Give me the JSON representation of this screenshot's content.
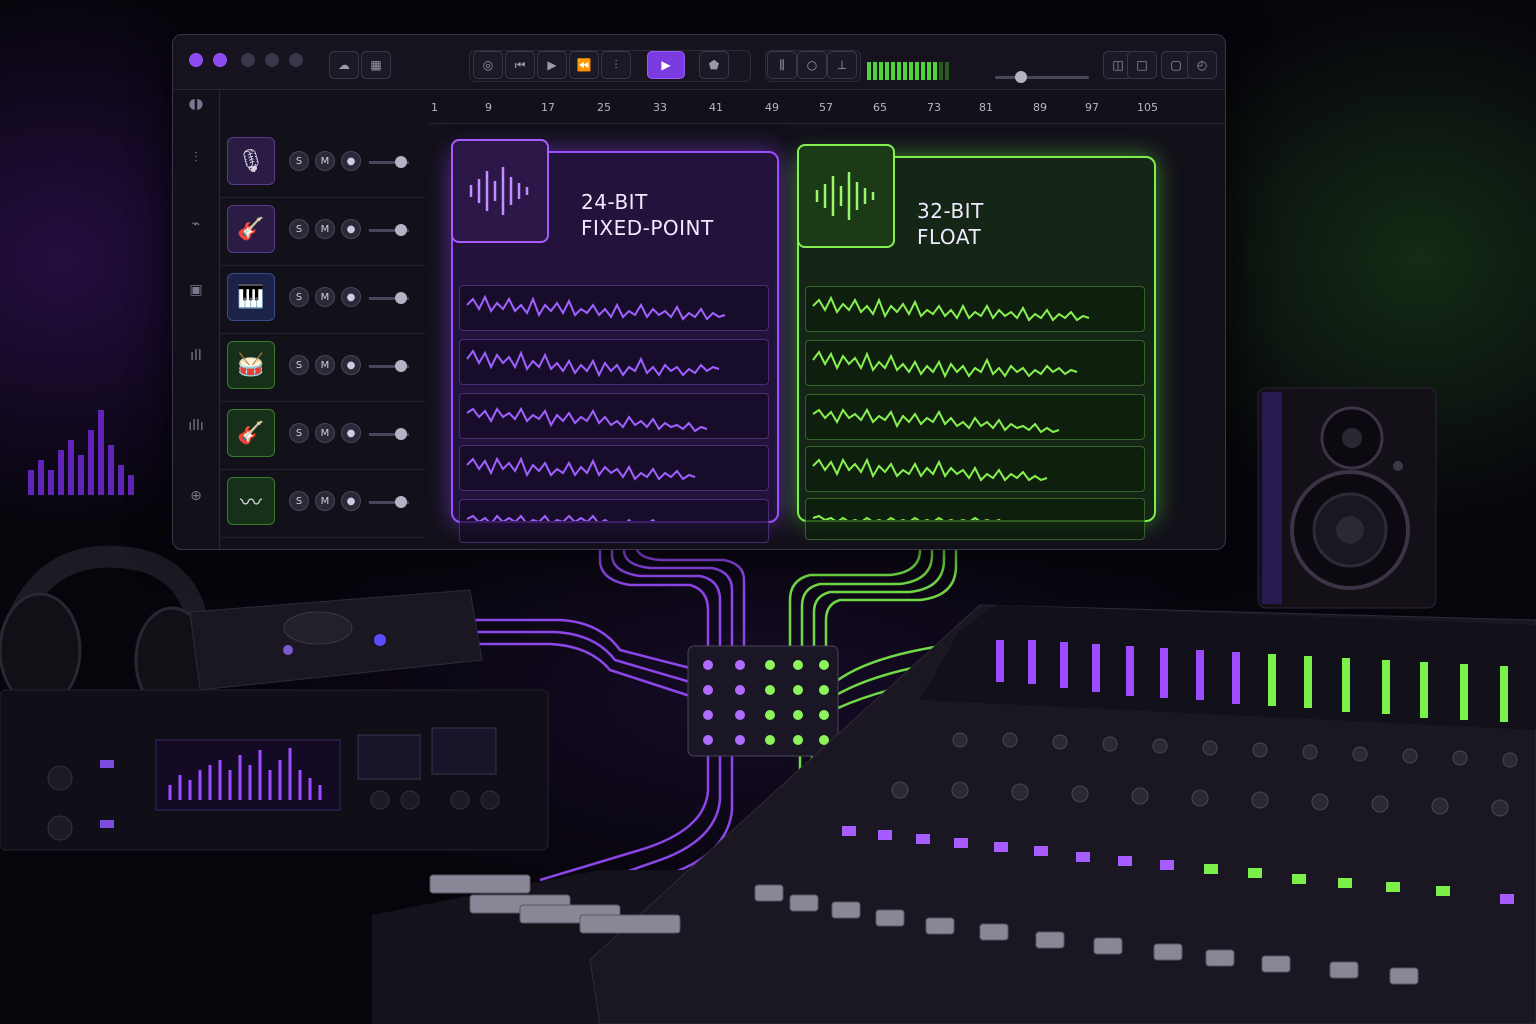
{
  "colors": {
    "purple": "#9b4dff",
    "green": "#7cf04a",
    "background": "#07050c"
  },
  "toolbar": {
    "window_dots": [
      "#8e4cf0",
      "#8e4cf0",
      "#3a3548",
      "#3a3548",
      "#3a3548"
    ],
    "buttons": [
      "cloud-icon",
      "grid-icon",
      "loop-icon",
      "rewind-icon",
      "play-icon",
      "skip-back-icon",
      "marker-icon",
      "play-button",
      "tag-icon",
      "trim-icon",
      "record-icon",
      "wave-icon",
      "window-icon",
      "window-icon",
      "window-icon",
      "settings-icon"
    ]
  },
  "sidebar": {
    "icons": [
      "audio-wave-icon",
      "waveform-icon",
      "link-icon",
      "plugin-icon",
      "bars-icon",
      "waves-icon",
      "export-icon"
    ]
  },
  "tracks": [
    {
      "icon": "microphone-icon",
      "glyph": "🎙",
      "solo": "S",
      "mute": "M"
    },
    {
      "icon": "guitar-icon",
      "glyph": "🎸",
      "solo": "S",
      "mute": "M"
    },
    {
      "icon": "piano-icon",
      "glyph": "🎹",
      "solo": "S",
      "mute": "M"
    },
    {
      "icon": "drums-icon",
      "glyph": "🥁",
      "solo": "S",
      "mute": "M"
    },
    {
      "icon": "guitar-icon",
      "glyph": "🎸",
      "solo": "S",
      "mute": "M"
    },
    {
      "icon": "waveform-icon",
      "glyph": "〰",
      "solo": "S",
      "mute": "M"
    }
  ],
  "ruler": {
    "ticks": [
      "1",
      "9",
      "17",
      "25",
      "33",
      "41",
      "49",
      "57",
      "65",
      "73",
      "81",
      "89",
      "97",
      "105"
    ]
  },
  "cards": {
    "fixed": {
      "line1": "24-BIT",
      "line2": "FIXED-POINT"
    },
    "float": {
      "line1": "32-BIT",
      "line2": "FLOAT"
    }
  }
}
